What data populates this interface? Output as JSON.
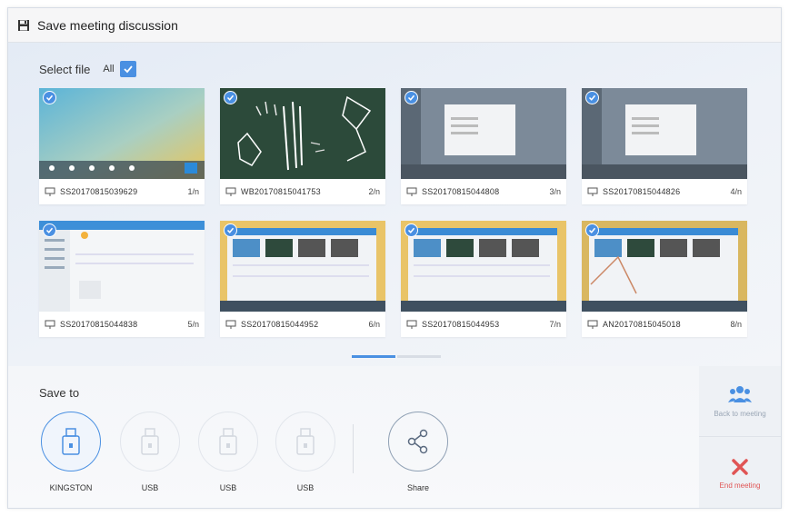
{
  "window": {
    "title": "Save meeting discussion"
  },
  "select": {
    "label": "Select file",
    "all_label": "All",
    "all_checked": true
  },
  "files": [
    {
      "name": "SS20170815039629",
      "page": "1/n",
      "kind": "desktop",
      "checked": true
    },
    {
      "name": "WB20170815041753",
      "page": "2/n",
      "kind": "whiteboard",
      "checked": true
    },
    {
      "name": "SS20170815044808",
      "page": "3/n",
      "kind": "dialog",
      "checked": true
    },
    {
      "name": "SS20170815044826",
      "page": "4/n",
      "kind": "dialog",
      "checked": true
    },
    {
      "name": "SS20170815044838",
      "page": "5/n",
      "kind": "window",
      "checked": true
    },
    {
      "name": "SS20170815044952",
      "page": "6/n",
      "kind": "app",
      "checked": true
    },
    {
      "name": "SS20170815044953",
      "page": "7/n",
      "kind": "app",
      "checked": true
    },
    {
      "name": "AN20170815045018",
      "page": "8/n",
      "kind": "app",
      "checked": true
    }
  ],
  "save_to": {
    "label": "Save to",
    "devices": [
      {
        "label": "KINGSTON",
        "active": true,
        "icon": "usb-drive-icon"
      },
      {
        "label": "USB",
        "active": false,
        "icon": "usb-drive-icon"
      },
      {
        "label": "USB",
        "active": false,
        "icon": "usb-drive-icon"
      },
      {
        "label": "USB",
        "active": false,
        "icon": "usb-drive-icon"
      }
    ],
    "share_label": "Share"
  },
  "sidebar": {
    "return_label": "Back to meeting",
    "end_label": "End meeting"
  },
  "colors": {
    "accent": "#4a90e2",
    "danger": "#e05555"
  }
}
